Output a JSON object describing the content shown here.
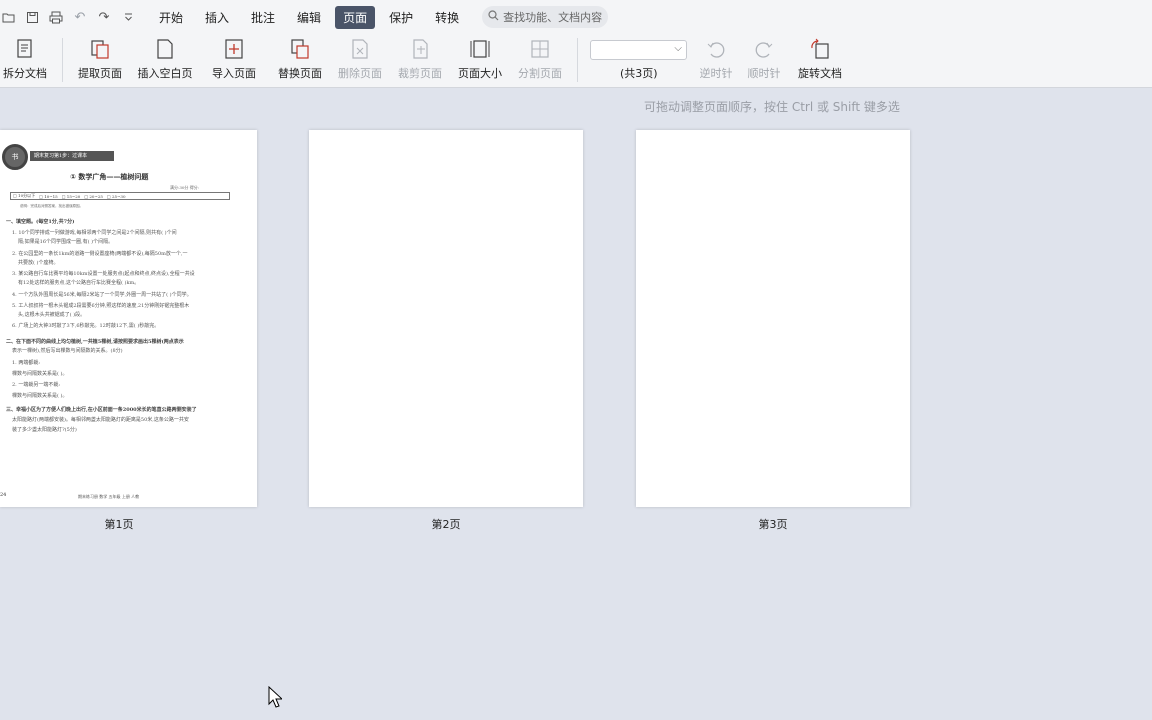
{
  "menubar": {
    "tabs": [
      {
        "label": "开始"
      },
      {
        "label": "插入"
      },
      {
        "label": "批注"
      },
      {
        "label": "编辑"
      },
      {
        "label": "页面"
      },
      {
        "label": "保护"
      },
      {
        "label": "转换"
      }
    ],
    "active_tab": "页面",
    "search_placeholder": "查找功能、文档内容"
  },
  "ribbon": {
    "split_doc": "拆分文档",
    "extract_page": "提取页面",
    "insert_blank": "插入空白页",
    "import_page": "导入页面",
    "replace_page": "替换页面",
    "delete_page": "删除页面",
    "crop_page": "裁剪页面",
    "page_size": "页面大小",
    "split_page": "分割页面",
    "page_total": "(共3页)",
    "rotate_ccw": "逆时针",
    "rotate_cw": "顺时针",
    "rotate_doc": "旋转文档"
  },
  "hint": "可拖动调整页面顺序，按住 Ctrl 或 Shift 键多选",
  "pages": [
    {
      "label": "第1页"
    },
    {
      "label": "第2页"
    },
    {
      "label": "第3页"
    }
  ],
  "doc": {
    "banner": "期末复习第1步：过课本",
    "title": "① 数学广角——植树问题",
    "score": "满分:30分  得分:",
    "rowbar": [
      "□ 10分以下",
      "□ 10~15",
      "□ 15~20",
      "□ 20~25",
      "□ 25~30"
    ],
    "note": "说明：完成后对照答案，找出错误原因。",
    "section1": "一、填空题。(每空1分,共7分)",
    "q1": "1. 10个同学排成一列做游戏,每相邻两个同学之间是2个间隔,则共有(     )个间",
    "q1b": "隔;如果是16个同学围成一圈,有(     )个间隔。",
    "q2": "2. 在公园里的一条长1km的道路一侧设置座椅(两端都不设),每隔50m放一个,一",
    "q2b": "共要放(     )个座椅。",
    "q3": "3. 某公路自行车比赛平均每10km设置一处服务点(起点和终点,终点设),全程一共设",
    "q3b": "有12处这样的服务点,这个公路自行车比赛全程(      )km。",
    "q4": "4. 一个方队外围周长是56米,每隔2米站了一个同学,外圈一周一共站了(     )个同学。",
    "q5": "5. 工人叔叔将一根木头锯成2段需要6分钟,照这样的速度,21分钟刚好锯完整根木",
    "q5b": "头,这根木头共被锯成了(      )段。",
    "q6": "6. 广场上的大钟3时敲了3下,6秒敲完。12时敲12下,需(     )秒敲完。",
    "section2": "二、在下面不同的曲线上均匀植树,一共植5棵树,请按照要求画出5棵树(两点表示",
    "section2b": "表示一棵树),然后写出棵数与间隔数的关系。(8分)",
    "s2a": "1. 两端都栽:",
    "s2a2": "   棵数与间隔数关系是(                         )。",
    "s2b": "2. 一端栽另一端不栽:",
    "s2b2": "   棵数与间隔数关系是(                         )。",
    "section3": "三、幸福小区为了方便人们晚上出行,在小区前面一条2000米长的笔直公路两侧安装了",
    "section3b": "太阳能路灯(两端都安装)。每相邻两盏太阳能路灯的距离是50米,这条公路一共安",
    "section3c": "装了多少盏太阳能路灯?(5分)",
    "footer_page": "24",
    "footer_text": "期末练习册   数学   五年级   上册   人教"
  }
}
